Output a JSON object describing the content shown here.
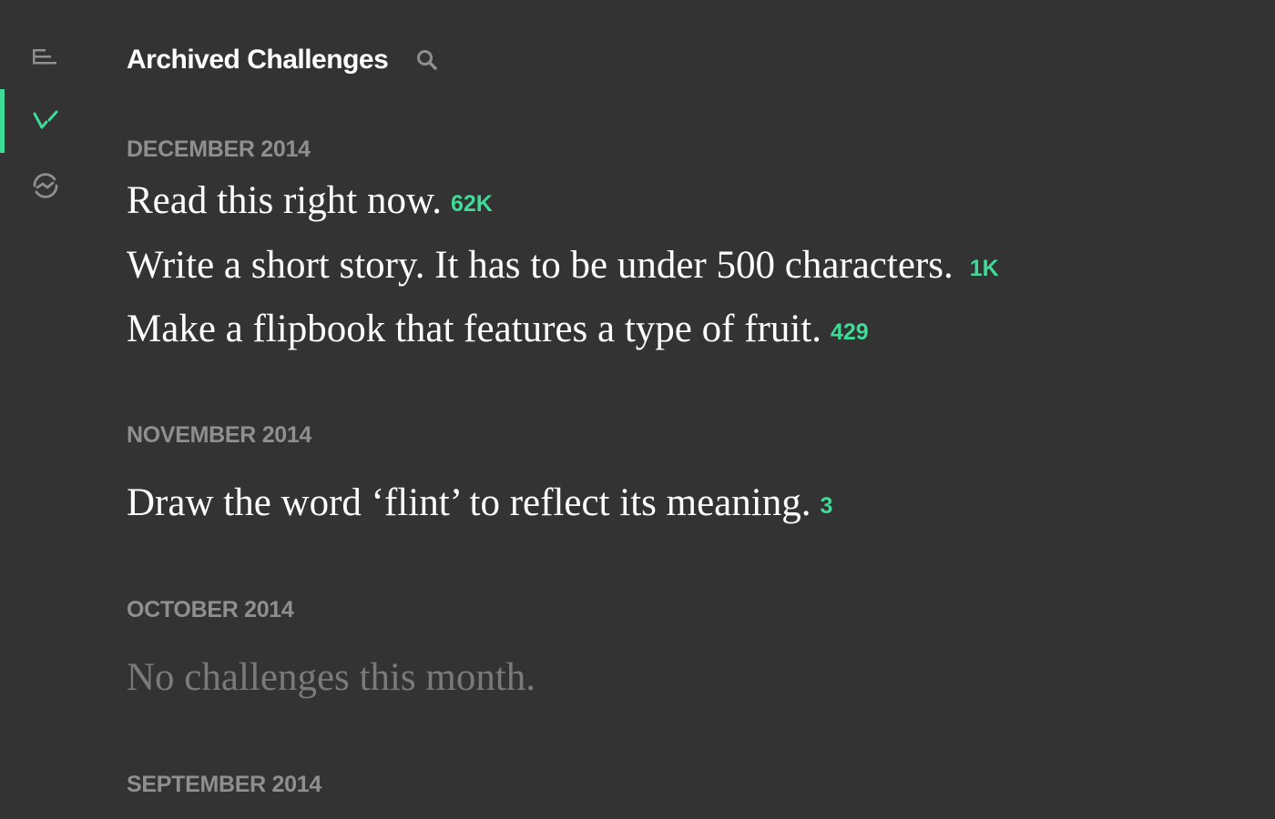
{
  "header": {
    "title": "Archived Challenges",
    "search_icon": "search-icon"
  },
  "nav": {
    "items": [
      {
        "icon": "menu-lines-icon",
        "active": false
      },
      {
        "icon": "checkmark-icon",
        "active": true
      },
      {
        "icon": "refresh-cycle-icon",
        "active": false
      }
    ]
  },
  "colors": {
    "background": "#333333",
    "accent": "#3ddc97",
    "muted": "#8f8f8f"
  },
  "sections": [
    {
      "heading": "DECEMBER 2014",
      "challenges": [
        {
          "text": "Read this right now.",
          "count": "62K"
        },
        {
          "text": "Write a short story. It has to be under 500 characters.",
          "count": "1K"
        },
        {
          "text": "Make a flipbook that features a type of fruit.",
          "count": "429"
        }
      ]
    },
    {
      "heading": "NOVEMBER 2014",
      "challenges": [
        {
          "text": "Draw the word ‘flint’ to reflect its meaning.",
          "count": "3"
        }
      ]
    },
    {
      "heading": "OCTOBER 2014",
      "empty_text": "No challenges this month."
    },
    {
      "heading": "SEPTEMBER 2014"
    }
  ]
}
